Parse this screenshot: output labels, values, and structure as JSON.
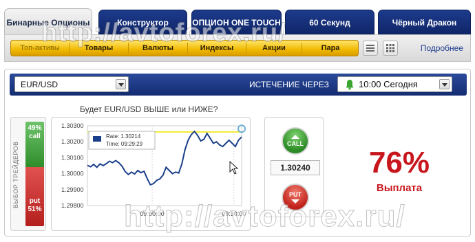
{
  "tabs": [
    {
      "label": "Бинарные Опционы",
      "active": true
    },
    {
      "label": "Конструктор"
    },
    {
      "label": "ОПЦИОН ONE TOUCH"
    },
    {
      "label": "60 Секунд"
    },
    {
      "label": "Чёрный Дракон"
    }
  ],
  "subnav": {
    "items": [
      "Топ-активы",
      "Товары",
      "Валюты",
      "Индексы",
      "Акции",
      "Пара"
    ],
    "more_link": "Подробнее"
  },
  "trade": {
    "asset": "EUR/USD",
    "expiry_label": "ИСТЕЧЕНИЕ ЧЕРЕЗ",
    "expiry_value": "10:00 Сегодня",
    "question": "Будет EUR/USD ВЫШЕ или НИЖЕ?",
    "traders_label": "ВЫБОР ТРЕЙДЕРОВ",
    "call_pct": "49%",
    "call_label": "call",
    "put_label": "put",
    "put_pct": "51%",
    "call_button": "CALL",
    "put_button": "PUT",
    "price": "1.30240",
    "payout_pct": "76%",
    "payout_label": "Выплата"
  },
  "chart_data": {
    "type": "line",
    "ylim": [
      1.298,
      1.303
    ],
    "yticks": [
      "1.30300",
      "1.30200",
      "1.30100",
      "1.30000",
      "1.29900",
      "1.29800"
    ],
    "xticks": [
      "09:00:00",
      "09:30:00"
    ],
    "tooltip": {
      "rate": "Rate: 1.30214",
      "time": "Time: 09:29:29"
    },
    "strike": 1.30262,
    "series": [
      {
        "values": [
          1.30052,
          1.30043,
          1.30058,
          1.3004,
          1.30061,
          1.3005,
          1.30063,
          1.30078,
          1.30069,
          1.30082,
          1.30068,
          1.30047,
          1.30013,
          1.29995,
          1.3001,
          1.29998,
          1.3002,
          1.30006,
          1.30015,
          1.29968,
          1.2993,
          1.29938,
          1.29958,
          1.29967,
          1.2999,
          1.3004,
          1.3002,
          1.3,
          1.3001,
          1.30004,
          1.3006,
          1.3015,
          1.3021,
          1.30245,
          1.30265,
          1.3024,
          1.30205,
          1.30215,
          1.30252,
          1.30222,
          1.3019,
          1.302,
          1.3018,
          1.3017,
          1.3019,
          1.3021,
          1.3019,
          1.3017,
          1.3021,
          1.3023
        ]
      }
    ],
    "x_progress": 1.0
  },
  "watermark": "http://avtoforex.ru/"
}
